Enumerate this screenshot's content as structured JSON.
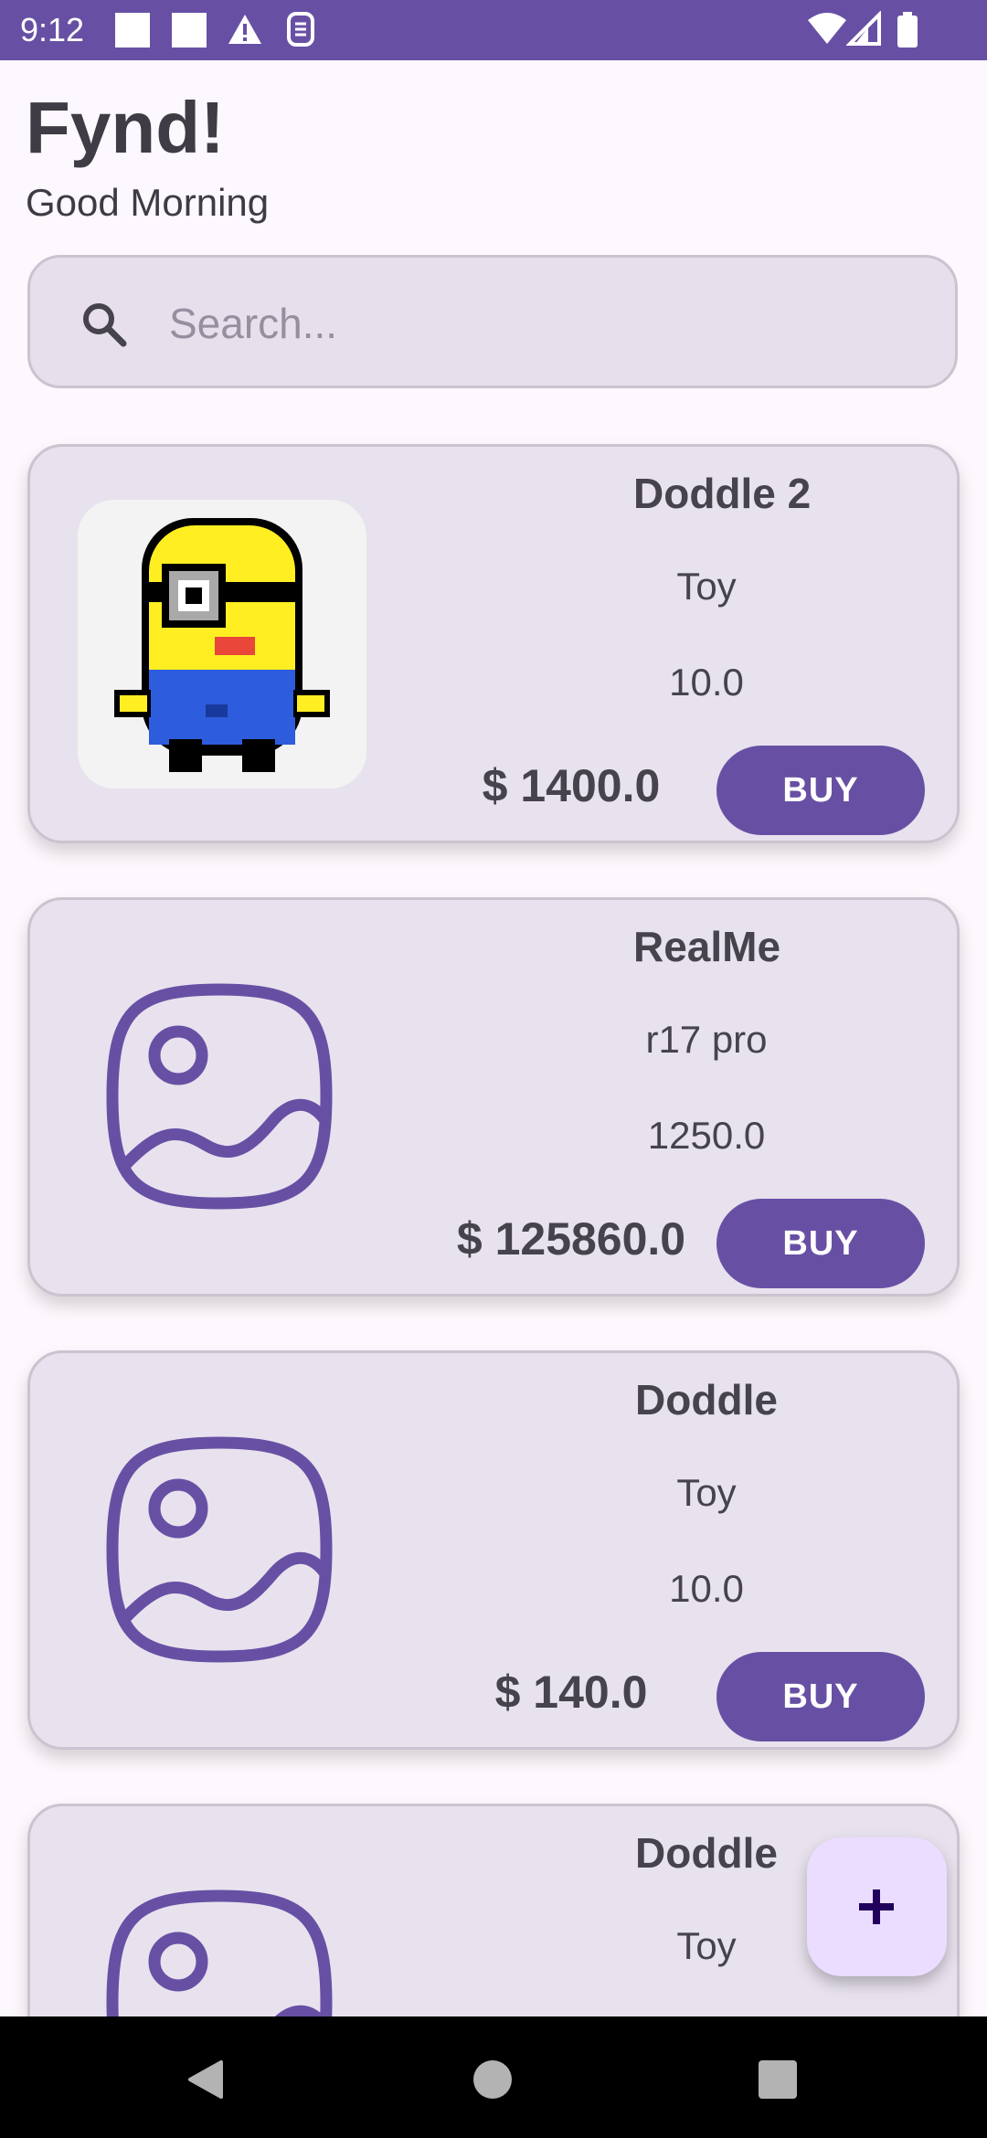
{
  "status_bar": {
    "time": "9:12",
    "icons": [
      "notification-square-icon",
      "notification-square-icon",
      "warning-icon",
      "sim-icon",
      "wifi-icon",
      "signal-icon",
      "battery-icon"
    ],
    "background": "#6750a4"
  },
  "header": {
    "title": "Fynd!",
    "greeting": "Good Morning"
  },
  "search": {
    "placeholder": "Search..."
  },
  "products": [
    {
      "name": "Doddle 2",
      "category": "Toy",
      "value": "10.0",
      "price": "$ 1400.0",
      "image": "minion-pixel-art",
      "buy_label": "BUY"
    },
    {
      "name": "RealMe",
      "category": "r17 pro",
      "value": "1250.0",
      "price": "$ 125860.0",
      "image": "image-placeholder-icon",
      "buy_label": "BUY"
    },
    {
      "name": "Doddle",
      "category": "Toy",
      "value": "10.0",
      "price": "$ 140.0",
      "image": "image-placeholder-icon",
      "buy_label": "BUY"
    },
    {
      "name": "Doddle",
      "category": "Toy",
      "value": "",
      "price": "",
      "image": "image-placeholder-icon",
      "buy_label": ""
    }
  ],
  "fab": {
    "icon": "plus-icon"
  },
  "colors": {
    "primary": "#6750a4",
    "card": "#e8e2ee",
    "fab": "#eaddff"
  }
}
